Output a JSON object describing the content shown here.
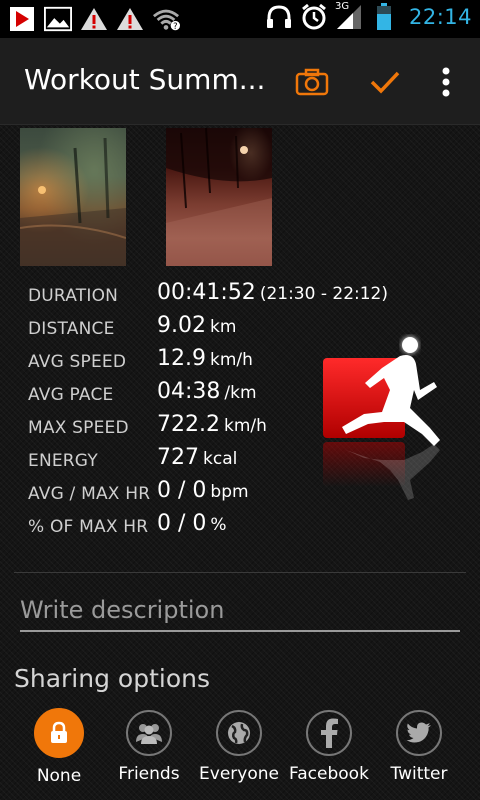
{
  "statusbar": {
    "time": "22:14",
    "network": "3G",
    "icons": [
      "youtube-icon",
      "gallery-icon",
      "warning-icon",
      "warning-icon",
      "wifi-icon",
      "headphones-icon",
      "alarm-icon",
      "signal-icon",
      "battery-icon"
    ]
  },
  "actionbar": {
    "title": "Workout Summ...",
    "camera_icon": "camera-icon",
    "confirm_icon": "checkmark-icon",
    "overflow_icon": "overflow-menu-icon",
    "accent": "#f0770a"
  },
  "stats": [
    {
      "label": "DURATION",
      "value": "00:41:52",
      "unit": "(21:30 - 22:12)"
    },
    {
      "label": "DISTANCE",
      "value": "9.02",
      "unit": "km"
    },
    {
      "label": "AVG SPEED",
      "value": "12.9",
      "unit": "km/h"
    },
    {
      "label": "AVG PACE",
      "value": "04:38",
      "unit": "/km"
    },
    {
      "label": "MAX SPEED",
      "value": "722.2",
      "unit": "km/h"
    },
    {
      "label": "ENERGY",
      "value": "727",
      "unit": "kcal"
    },
    {
      "label": "AVG / MAX HR",
      "value": "0 / 0",
      "unit": "bpm"
    },
    {
      "label": "% OF MAX HR",
      "value": "0 / 0",
      "unit": "%"
    }
  ],
  "description": {
    "placeholder": "Write description",
    "value": ""
  },
  "sharing": {
    "title": "Sharing options",
    "selected": "None",
    "options": [
      {
        "label": "None",
        "icon": "lock-icon"
      },
      {
        "label": "Friends",
        "icon": "friends-icon"
      },
      {
        "label": "Everyone",
        "icon": "globe-icon"
      },
      {
        "label": "Facebook",
        "icon": "facebook-icon"
      },
      {
        "label": "Twitter",
        "icon": "twitter-icon"
      }
    ]
  }
}
